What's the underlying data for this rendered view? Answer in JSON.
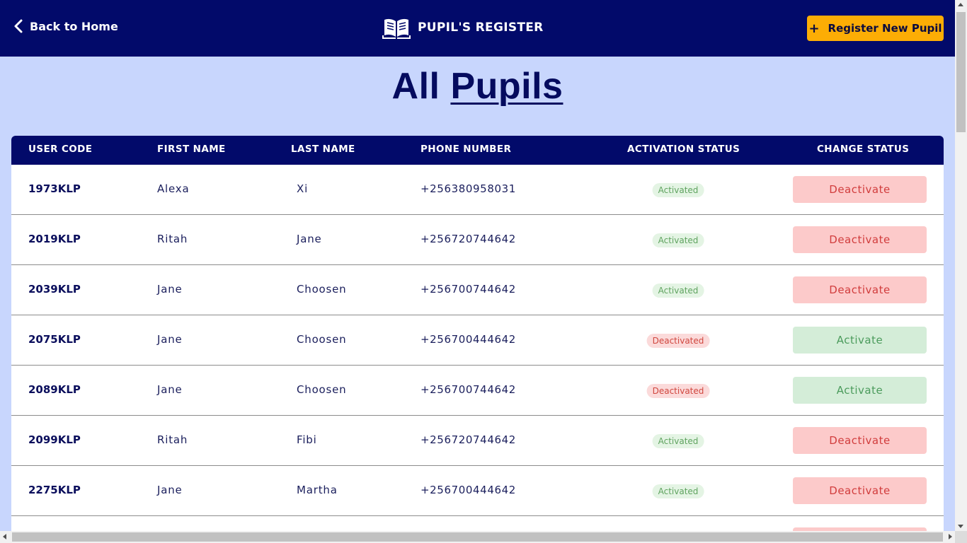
{
  "header": {
    "back_label": "Back to Home",
    "brand_title": "PUPIL'S REGISTER",
    "register_label": "Register New Pupil",
    "register_plus": "+"
  },
  "page": {
    "title_word1": "All",
    "title_word2": "Pupils"
  },
  "table": {
    "headers": [
      "USER CODE",
      "FIRST NAME",
      "LAST NAME",
      "PHONE NUMBER",
      "ACTIVATION STATUS",
      "CHANGE STATUS"
    ],
    "rows": [
      {
        "code": "1973KLP",
        "first": "Alexa",
        "last": "Xi",
        "phone": "+256380958031",
        "status": "Activated",
        "action": "Deactivate"
      },
      {
        "code": "2019KLP",
        "first": "Ritah",
        "last": "Jane",
        "phone": "+256720744642",
        "status": "Activated",
        "action": "Deactivate"
      },
      {
        "code": "2039KLP",
        "first": "Jane",
        "last": "Choosen",
        "phone": "+256700744642",
        "status": "Activated",
        "action": "Deactivate"
      },
      {
        "code": "2075KLP",
        "first": "Jane",
        "last": "Choosen",
        "phone": "+256700444642",
        "status": "Deactivated",
        "action": "Activate"
      },
      {
        "code": "2089KLP",
        "first": "Jane",
        "last": "Choosen",
        "phone": "+256700744642",
        "status": "Deactivated",
        "action": "Activate"
      },
      {
        "code": "2099KLP",
        "first": "Ritah",
        "last": "Fibi",
        "phone": "+256720744642",
        "status": "Activated",
        "action": "Deactivate"
      },
      {
        "code": "2275KLP",
        "first": "Jane",
        "last": "Martha",
        "phone": "+256700444642",
        "status": "Activated",
        "action": "Deactivate"
      }
    ]
  },
  "colors": {
    "navy": "#020a6a",
    "background": "#c8d6fd",
    "accent": "#fcad05",
    "activated": "#5fa35f",
    "deactivated": "#d0473f"
  },
  "icons": {
    "back": "chevron-left-icon",
    "brand": "open-book-icon"
  }
}
